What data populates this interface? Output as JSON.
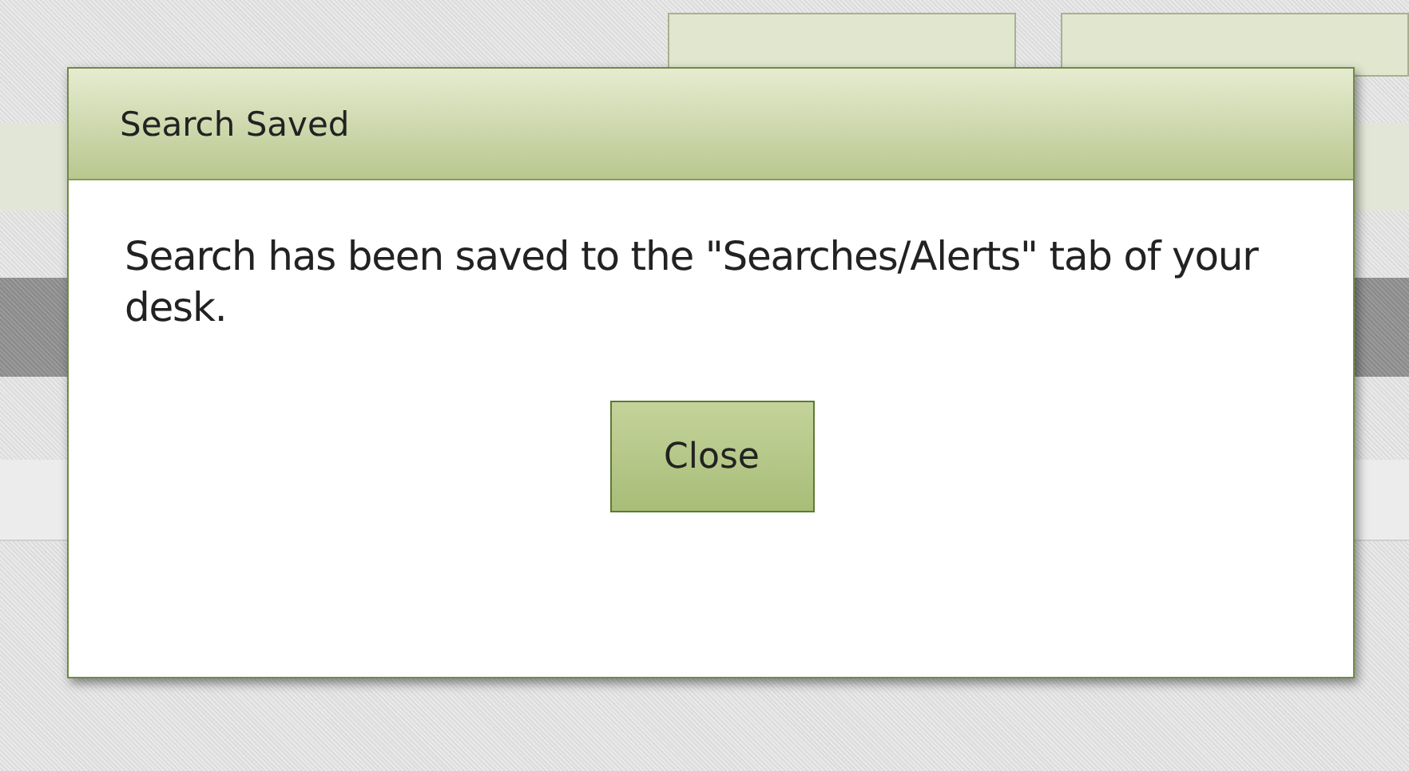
{
  "dialog": {
    "title": "Search Saved",
    "message": "Search has been saved to the \"Searches/Alerts\" tab of your desk.",
    "buttons": [
      "Close"
    ]
  }
}
